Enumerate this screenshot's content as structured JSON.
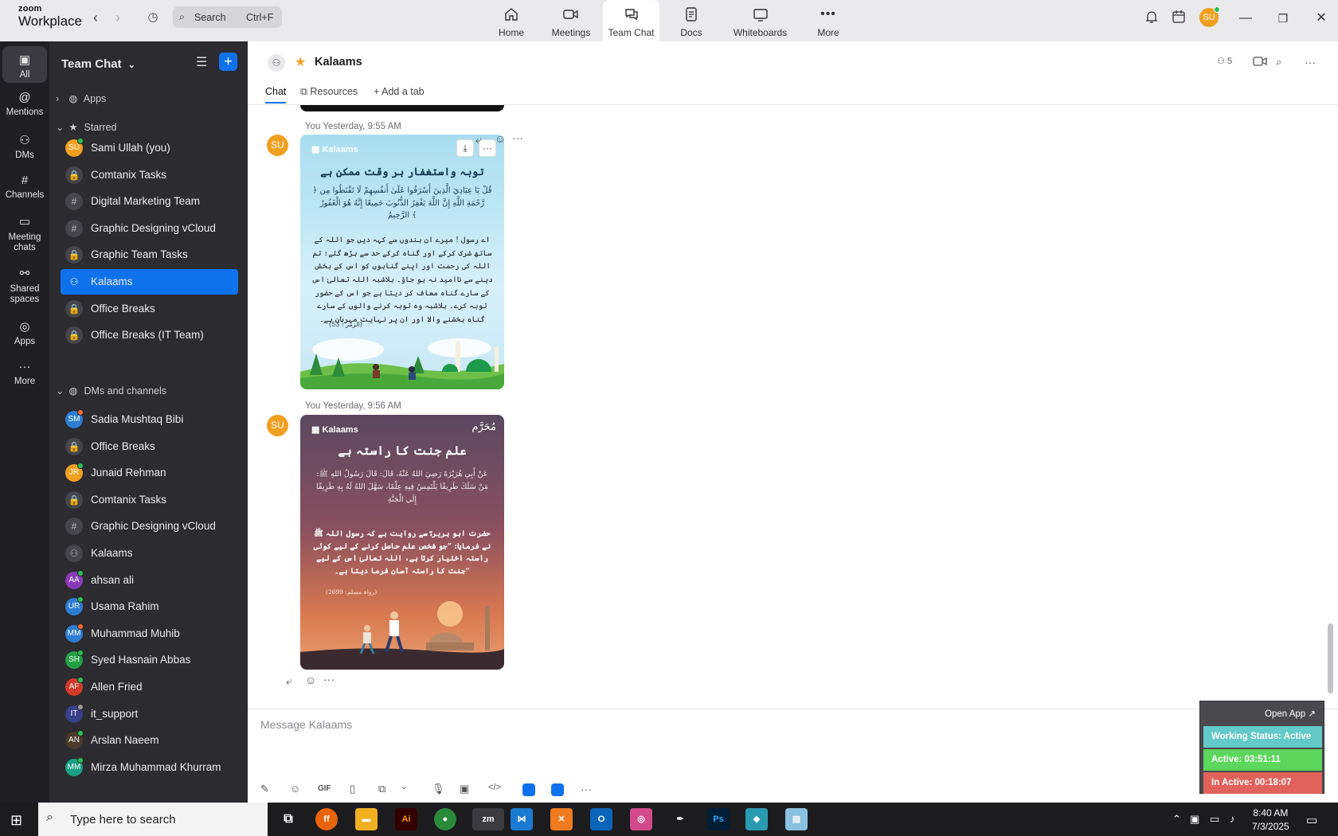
{
  "topbar": {
    "logo_line1": "zoom",
    "logo_line2": "Workplace",
    "search_placeholder": "Search",
    "search_shortcut": "Ctrl+F",
    "tabs": [
      {
        "label": "Home",
        "icon": "home-icon"
      },
      {
        "label": "Meetings",
        "icon": "video-icon"
      },
      {
        "label": "Team Chat",
        "icon": "chat-icon"
      },
      {
        "label": "Docs",
        "icon": "doc-icon"
      },
      {
        "label": "Whiteboards",
        "icon": "whiteboard-icon"
      },
      {
        "label": "More",
        "icon": "more-icon"
      }
    ],
    "avatar_initials": "SU"
  },
  "rail": {
    "items": [
      {
        "label": "All",
        "icon": "chat-bubble-icon"
      },
      {
        "label": "Mentions",
        "icon": "at-icon"
      },
      {
        "label": "DMs",
        "icon": "people-icon"
      },
      {
        "label": "Channels",
        "icon": "hash-icon"
      },
      {
        "label": "Meeting chats",
        "icon": "calendar-icon"
      },
      {
        "label": "Shared spaces",
        "icon": "shared-icon"
      },
      {
        "label": "Apps",
        "icon": "apps-icon"
      },
      {
        "label": "More",
        "icon": "more-icon"
      }
    ]
  },
  "panel": {
    "title": "Team Chat",
    "sections": {
      "apps": "Apps",
      "starred": "Starred",
      "dms": "DMs and channels"
    },
    "starred": [
      {
        "name": "Sami Ullah (you)",
        "initials": "SU",
        "color": "#f0a020",
        "status": "#23c552"
      },
      {
        "name": "Comtanix Tasks",
        "icon": "lock-icon"
      },
      {
        "name": "Digital Marketing Team",
        "icon": "hash-icon"
      },
      {
        "name": "Graphic Designing vCloud",
        "icon": "hash-icon"
      },
      {
        "name": "Graphic Team Tasks",
        "icon": "lock-icon"
      },
      {
        "name": "Kalaams",
        "icon": "people-icon",
        "active": true
      },
      {
        "name": "Office Breaks",
        "icon": "lock-icon"
      },
      {
        "name": "Office Breaks (IT Team)",
        "icon": "lock-icon"
      }
    ],
    "dms": [
      {
        "name": "Sadia Mushtaq Bibi",
        "initials": "SM",
        "color": "#2d7dd2",
        "status": "#ff6a2a"
      },
      {
        "name": "Office Breaks",
        "icon": "lock-icon"
      },
      {
        "name": "Junaid Rehman",
        "initials": "JR",
        "color": "#f0a020",
        "status": "#23c552"
      },
      {
        "name": "Comtanix Tasks",
        "icon": "lock-icon"
      },
      {
        "name": "Graphic Designing vCloud",
        "icon": "hash-icon"
      },
      {
        "name": "Kalaams",
        "icon": "people-icon"
      },
      {
        "name": "ahsan ali",
        "initials": "AA",
        "color": "#8a3ab9",
        "status": "#23c552"
      },
      {
        "name": "Usama Rahim",
        "initials": "UR",
        "color": "#2d7dd2",
        "status": "#23c552"
      },
      {
        "name": "Muhammad Muhib",
        "initials": "MM",
        "color": "#2d7dd2",
        "status": "#ff6a2a"
      },
      {
        "name": "Syed Hasnain Abbas",
        "initials": "SH",
        "color": "#22a045",
        "status": "#23c552"
      },
      {
        "name": "Allen Fried",
        "initials": "AF",
        "color": "#d13a2a",
        "status": "#23c552"
      },
      {
        "name": "it_support",
        "initials": "IT",
        "color": "#3a3f8a",
        "status": "#9a9a9a"
      },
      {
        "name": "Arslan Naeem",
        "initials": "AN",
        "color": "#4a3a2a",
        "status": "#23c552"
      },
      {
        "name": "Mirza Muhammad Khurram",
        "initials": "MM",
        "color": "#1aa085",
        "status": "#23c552"
      }
    ]
  },
  "channel": {
    "name": "Kalaams",
    "member_count": "5",
    "tabs": {
      "chat": "Chat",
      "resources": "Resources",
      "add": "Add a tab"
    },
    "messages": [
      {
        "sender": "You",
        "time": "Yesterday, 9:55 AM",
        "avatar": "SU",
        "brand": "Kalaams",
        "title": "توبہ واستغفار ہر وقت ممکن ہے",
        "arabic": "﴿ قُلْ يَا عِبَادِيَ الَّذِينَ أَسْرَفُوا عَلَىٰ أَنفُسِهِمْ لَا تَقْنَطُوا مِن رَّحْمَةِ اللَّهِ إِنَّ اللَّهَ يَغْفِرُ الذُّنُوبَ جَمِيعًا إِنَّهُ هُوَ الْغَفُورُ الرَّحِيمُ ﴾",
        "urdu": "اے رسول ! میرے ان بندوں سے کہہ دیں جو اللہ کے ساتھ شرک کرکے اور گناہ کرکے حد سے بڑھ گئے؛ تم اللہ کی رحمت اور اپنے گناہوں کو اس کے بخش دینے سے ناامید نہ ہو جاؤ۔ بلاشبہ اللہ تعالیٰ اس کے سارے گناہ معاف کر دیتا ہے جو اس کے حضور توبہ کرے۔ بلاشبہ وہ توبہ کرنے والوں کے سارے گناہ بخشنے والا اور ان پر نہایت مہربان ہے۔",
        "ref": "(الزمر : 53)"
      },
      {
        "sender": "You",
        "time": "Yesterday, 9:56 AM",
        "avatar": "SU",
        "brand": "Kalaams",
        "corner": "مُحَرَّم",
        "title": "علم جنت کا راستہ ہے",
        "arabic": "عَنْ أَبِي هُرَيْرَةَ رَضِيَ اللهُ عَنْهُ، قَالَ: قَالَ رَسُولُ اللهِ ﷺ: مَنْ سَلَكَ طَرِيقًا يَلْتَمِسُ فِيهِ عِلْمًا، سَهَّلَ اللهُ لَهُ بِهِ طَرِيقًا إِلَى الْجَنَّةِ",
        "urdu": "حضرت ابو ہریرہؓ سے روایت ہے کہ رسول اللہ ﷺ نے فرمایا: ”جو شخص علم حاصل کرنے کے لیے کوئی راستہ اختیار کرتا ہے، اللہ تعالیٰ اس کے لیے جنت کا راستہ آسان فرما دیتا ہے۔“",
        "ref": "(رواہ مسلم: 2699)"
      }
    ],
    "composer_placeholder": "Message Kalaams",
    "composer_gif": "GIF"
  },
  "widget": {
    "open_app": "Open App ↗",
    "working_status": "Working Status: Active",
    "active": "Active: 03:51:11",
    "inactive": "In Active: 00:18:07",
    "colors": {
      "status": "#63c9c9",
      "active": "#5cd65c",
      "inactive": "#e0625a"
    }
  },
  "taskbar": {
    "search_placeholder": "Type here to search",
    "apps": [
      "Firefox",
      "File Explorer",
      "Illustrator",
      "Chrome",
      "Zoom",
      "VS Code",
      "XAMPP",
      "Outlook",
      "Creative Cloud",
      "Inkscape",
      "Photoshop",
      "App",
      "Notepad"
    ],
    "time": "8:40 AM",
    "date": "7/3/2025"
  }
}
